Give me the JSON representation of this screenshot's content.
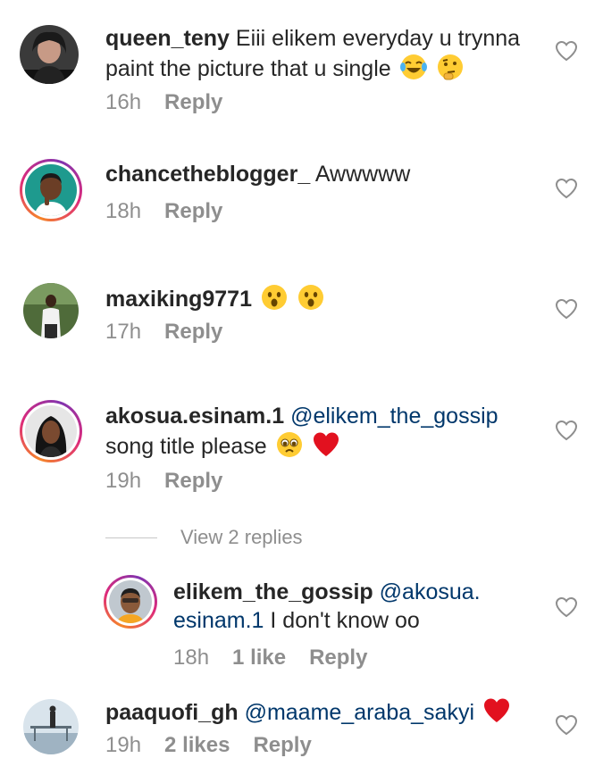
{
  "comments": [
    {
      "username": "queen_teny",
      "text": "Eiii elikem everyday u trynna paint the picture that u single",
      "emojis": [
        "face-with-tears-of-joy-emoji",
        "thinking-face-emoji"
      ],
      "time": "16h",
      "reply_label": "Reply"
    },
    {
      "username": "chancetheblogger_",
      "text": "Awwwww",
      "time": "18h",
      "reply_label": "Reply"
    },
    {
      "username": "maxiking9771",
      "text": "",
      "emojis": [
        "astonished-face-emoji",
        "astonished-face-emoji"
      ],
      "time": "17h",
      "reply_label": "Reply"
    },
    {
      "username": "akosua.esinam.1",
      "mention": "@elikem_the_gossip",
      "text": "song title please",
      "emojis": [
        "pleading-face-emoji",
        "red-heart-emoji"
      ],
      "time": "19h",
      "reply_label": "Reply",
      "view_replies": "View 2 replies"
    },
    {
      "username": "elikem_the_gossip",
      "mention": "@akosua. esinam.1",
      "text": "I don't know oo",
      "time": "18h",
      "likes": "1 like",
      "reply_label": "Reply"
    },
    {
      "username": "paaquofi_gh",
      "mention": "@maame_araba_sakyi",
      "emojis": [
        "red-heart-emoji"
      ],
      "time": "19h",
      "likes": "2 likes",
      "reply_label": "Reply"
    }
  ],
  "colors": {
    "text": "#262626",
    "mention": "#00376b",
    "meta": "#8e8e8e",
    "heart_outline": "#8e8e8e"
  },
  "icons": {
    "like": "heart-outline-icon"
  }
}
